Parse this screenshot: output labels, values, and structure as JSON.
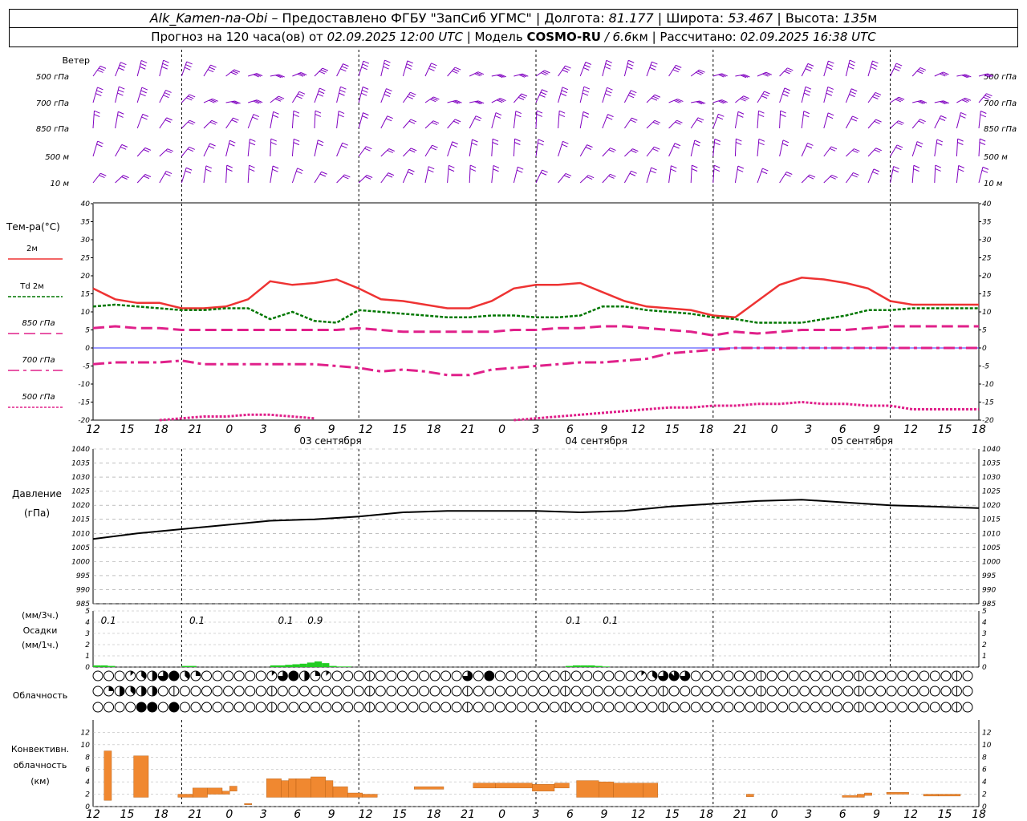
{
  "header": {
    "station": "Alk_Kamen-na-Obi",
    "provider": "– Предоставлено ФГБУ \"ЗапСиб УГМС\"",
    "lon_label": "| Долгота:",
    "lon": "81.177",
    "lat_label": "| Широта:",
    "lat": "53.467",
    "alt_label": "| Высота:",
    "alt": "135",
    "alt_unit": "м",
    "forecast_label": "Прогноз на 120 часа(ов) от",
    "forecast_from": "02.09.2025 12:00 UTC",
    "model_label": "| Модель",
    "model": "COSMO-RU",
    "resolution": "/ 6.6",
    "res_unit": "км",
    "calc_label": "| Рассчитано:",
    "calc_time": "02.09.2025 16:38 UTC"
  },
  "labels": {
    "wind": "Ветер",
    "wind_levels": [
      "500 гПа",
      "700 гПа",
      "850 гПа",
      "500 м",
      "10 м"
    ],
    "temp_title": "Тем-ра(°С)",
    "t2m": "2м",
    "td_prefix": "Td",
    "td_suffix": "2м",
    "t850": "850 гПа",
    "t700": "700 гПа",
    "t500": "500 гПа",
    "pressure_title": "Давление",
    "pressure_unit": "(гПа)",
    "precip_unit3": "(мм/3ч.)",
    "precip_title": "Осадки",
    "precip_unit1": "(мм/1ч.)",
    "cloud_title": "Облачность",
    "conv_line1": "Конвективн.",
    "conv_line2": "облачность",
    "conv_unit": "(км)"
  },
  "time_axis": {
    "hours": [
      "12",
      "15",
      "18",
      "21",
      "0",
      "3",
      "6",
      "9",
      "12",
      "15",
      "18",
      "21",
      "0",
      "3",
      "6",
      "9",
      "12",
      "15",
      "18",
      "21",
      "0",
      "3",
      "6",
      "9",
      "12",
      "15",
      "18"
    ],
    "dates": [
      "03 сентября",
      "04 сентября",
      "05 сентября"
    ]
  },
  "colors": {
    "wind": "#8000c0",
    "t2m": "#ee3333",
    "td": "#007700",
    "t850": "#e0208a",
    "t700": "#e0208a",
    "t500": "#e0208a",
    "zero_line": "#3333ff",
    "pressure": "#000000",
    "precip": "#22cc22",
    "conv": "#f08830"
  },
  "chart_data": [
    {
      "type": "line",
      "title": "Тем-ра(°С)",
      "ylim": [
        -20,
        40
      ],
      "x_hours": [
        0,
        3,
        6,
        9,
        12,
        15,
        18,
        21,
        24,
        27,
        30,
        33,
        36,
        39,
        42,
        45,
        48,
        51,
        54,
        57,
        60,
        63,
        66,
        69,
        72,
        75,
        78,
        81,
        84,
        87,
        90,
        93,
        96,
        99,
        102,
        105,
        108,
        111,
        114,
        117,
        120
      ],
      "series": [
        {
          "name": "2м",
          "values": [
            16.5,
            13.5,
            12.5,
            12.5,
            11.0,
            11.0,
            11.5,
            13.5,
            18.5,
            17.5,
            18.0,
            19.0,
            16.5,
            13.5,
            13.0,
            12.0,
            11.0,
            11.0,
            13.0,
            16.5,
            17.5,
            17.5,
            18.0,
            15.5,
            13.0,
            11.5,
            11.0,
            10.5,
            9.0,
            8.5,
            13.0,
            17.5,
            19.5,
            19.0,
            18.0,
            16.5,
            13.0,
            12.0,
            12.0,
            12.0,
            12.0
          ]
        },
        {
          "name": "Td 2м",
          "values": [
            11.5,
            12.0,
            11.5,
            11.0,
            10.5,
            10.5,
            11.0,
            11.0,
            8.0,
            10.0,
            7.5,
            7.0,
            10.5,
            10.0,
            9.5,
            9.0,
            8.5,
            8.5,
            9.0,
            9.0,
            8.5,
            8.5,
            9.0,
            11.5,
            11.5,
            10.5,
            10.0,
            9.5,
            8.5,
            8.0,
            7.0,
            7.0,
            7.0,
            8.0,
            9.0,
            10.5,
            10.5,
            11.0,
            11.0,
            11.0,
            11.0
          ]
        },
        {
          "name": "850 гПа",
          "values": [
            5.5,
            6.0,
            5.5,
            5.5,
            5.0,
            5.0,
            5.0,
            5.0,
            5.0,
            5.0,
            5.0,
            5.0,
            5.5,
            5.0,
            4.5,
            4.5,
            4.5,
            4.5,
            4.5,
            5.0,
            5.0,
            5.5,
            5.5,
            6.0,
            6.0,
            5.5,
            5.0,
            4.5,
            3.5,
            4.5,
            4.0,
            4.5,
            5.0,
            5.0,
            5.0,
            5.5,
            6.0,
            6.0,
            6.0,
            6.0,
            6.0
          ]
        },
        {
          "name": "700 гПа",
          "values": [
            -4.5,
            -4.0,
            -4.0,
            -4.0,
            -3.5,
            -4.5,
            -4.5,
            -4.5,
            -4.5,
            -4.5,
            -4.5,
            -5.0,
            -5.5,
            -6.5,
            -6.0,
            -6.5,
            -7.5,
            -7.5,
            -6.0,
            -5.5,
            -5.0,
            -4.5,
            -4.0,
            -4.0,
            -3.5,
            -3.0,
            -1.5,
            -1.0,
            -0.5,
            0.0,
            0.0,
            0.0,
            0.0,
            0.0,
            0.0,
            0.0,
            0.0,
            0.0,
            0.0,
            0.0,
            0.0
          ]
        },
        {
          "name": "500 гПа",
          "values": [
            null,
            null,
            null,
            -20.0,
            -19.5,
            -19.0,
            -19.0,
            -18.5,
            -18.5,
            -19.0,
            -19.5,
            null,
            null,
            null,
            null,
            null,
            null,
            null,
            null,
            -20.0,
            -19.5,
            -19.0,
            -18.5,
            -18.0,
            -17.5,
            -17.0,
            -16.5,
            -16.5,
            -16.0,
            -16.0,
            -15.5,
            -15.5,
            -15.0,
            -15.5,
            -15.5,
            -16.0,
            -16.0,
            -17.0,
            -17.0,
            -17.0,
            -17.0
          ]
        }
      ]
    },
    {
      "type": "line",
      "title": "Давление",
      "ylabel": "(гПа)",
      "ylim": [
        985,
        1040
      ],
      "x_hours": [
        0,
        6,
        12,
        18,
        24,
        30,
        36,
        42,
        48,
        54,
        60,
        66,
        72,
        78,
        84,
        90,
        96,
        102,
        108,
        114,
        120
      ],
      "series": [
        {
          "name": "Давление",
          "values": [
            1008,
            1010,
            1011.5,
            1013,
            1014.5,
            1015,
            1016,
            1017.5,
            1018,
            1018,
            1018,
            1017.5,
            1018,
            1019.5,
            1020.5,
            1021.5,
            1022,
            1021,
            1020,
            1019.5,
            1019
          ]
        }
      ]
    },
    {
      "type": "bar",
      "title": "Осадки",
      "ylim": [
        0,
        5
      ],
      "x_hours": [
        0,
        1,
        2,
        12,
        13,
        24,
        25,
        26,
        27,
        28,
        29,
        30,
        31,
        32,
        33,
        34,
        64,
        65,
        66,
        67,
        68,
        69
      ],
      "values": [
        0.15,
        0.15,
        0.1,
        0.1,
        0.1,
        0.15,
        0.15,
        0.2,
        0.25,
        0.3,
        0.4,
        0.5,
        0.35,
        0.1,
        0.05,
        0.05,
        0.1,
        0.15,
        0.15,
        0.15,
        0.1,
        0.05
      ],
      "totals_3h": [
        {
          "hour": 1,
          "label": "0.1"
        },
        {
          "hour": 13,
          "label": "0.1"
        },
        {
          "hour": 25,
          "label": "0.1"
        },
        {
          "hour": 29,
          "label": "0.9"
        },
        {
          "hour": 64,
          "label": "0.1"
        },
        {
          "hour": 69,
          "label": "0.1"
        }
      ]
    },
    {
      "type": "heatmap",
      "title": "Облачность",
      "rows": [
        "00013468320000001684210000000000006080000000000000136760000000000000000000000000000000000000000000006000000000000004000000000",
        "02434400000000000000000000000000000000000000000000000000000000000000000000000000000000000000000000004004000000000000000000000",
        "00008808000000000000000000000000000000000000000000000000000000000000000000000000000000000000000000000000000000000000000000000"
      ],
      "row_values_note": "cover in eighths"
    },
    {
      "type": "bar",
      "title": "Конвективн. облачность",
      "ylabel": "(км)",
      "ylim": [
        0,
        14
      ],
      "segments": [
        {
          "h0": 0,
          "h1": 1,
          "bottom": 1,
          "top": 9
        },
        {
          "h0": 4,
          "h1": 6,
          "bottom": 1.5,
          "top": 8.2
        },
        {
          "h0": 10,
          "h1": 12,
          "bottom": 1.5,
          "top": 2
        },
        {
          "h0": 12,
          "h1": 14,
          "bottom": 1.5,
          "top": 3
        },
        {
          "h0": 14,
          "h1": 16,
          "bottom": 2,
          "top": 3
        },
        {
          "h0": 16,
          "h1": 17,
          "bottom": 2,
          "top": 2.5
        },
        {
          "h0": 17,
          "h1": 18,
          "bottom": 2.5,
          "top": 3.3
        },
        {
          "h0": 19,
          "h1": 20,
          "bottom": 0.3,
          "top": 0.5
        },
        {
          "h0": 22,
          "h1": 24,
          "bottom": 1.5,
          "top": 4.5
        },
        {
          "h0": 24,
          "h1": 25,
          "bottom": 1.5,
          "top": 4.2
        },
        {
          "h0": 25,
          "h1": 26,
          "bottom": 1.5,
          "top": 4.5
        },
        {
          "h0": 26,
          "h1": 28,
          "bottom": 1.5,
          "top": 4.5
        },
        {
          "h0": 28,
          "h1": 30,
          "bottom": 1.5,
          "top": 4.8
        },
        {
          "h0": 30,
          "h1": 31,
          "bottom": 1.5,
          "top": 4.2
        },
        {
          "h0": 31,
          "h1": 33,
          "bottom": 1.5,
          "top": 3.2
        },
        {
          "h0": 33,
          "h1": 35,
          "bottom": 1.5,
          "top": 2.2
        },
        {
          "h0": 35,
          "h1": 37,
          "bottom": 1.5,
          "top": 2
        },
        {
          "h0": 42,
          "h1": 46,
          "bottom": 2.8,
          "top": 3.2
        },
        {
          "h0": 50,
          "h1": 53,
          "bottom": 3,
          "top": 3.8
        },
        {
          "h0": 53,
          "h1": 58,
          "bottom": 3,
          "top": 3.8
        },
        {
          "h0": 58,
          "h1": 61,
          "bottom": 2.5,
          "top": 3.6
        },
        {
          "h0": 61,
          "h1": 63,
          "bottom": 3,
          "top": 3.8
        },
        {
          "h0": 64,
          "h1": 67,
          "bottom": 1.5,
          "top": 4.2
        },
        {
          "h0": 67,
          "h1": 69,
          "bottom": 1.5,
          "top": 4
        },
        {
          "h0": 69,
          "h1": 73,
          "bottom": 1.5,
          "top": 3.8
        },
        {
          "h0": 73,
          "h1": 75,
          "bottom": 1.5,
          "top": 3.8
        },
        {
          "h0": 87,
          "h1": 88,
          "bottom": 1.6,
          "top": 2
        },
        {
          "h0": 100,
          "h1": 102,
          "bottom": 1.5,
          "top": 1.8
        },
        {
          "h0": 102,
          "h1": 103,
          "bottom": 1.5,
          "top": 2
        },
        {
          "h0": 103,
          "h1": 104,
          "bottom": 1.8,
          "top": 2.2
        },
        {
          "h0": 106,
          "h1": 109,
          "bottom": 2,
          "top": 2.3
        },
        {
          "h0": 111,
          "h1": 113,
          "bottom": 1.7,
          "top": 2
        },
        {
          "h0": 113,
          "h1": 116,
          "bottom": 1.7,
          "top": 2
        }
      ]
    }
  ],
  "wind": {
    "rows": 5,
    "note": "wind barbs per level"
  }
}
